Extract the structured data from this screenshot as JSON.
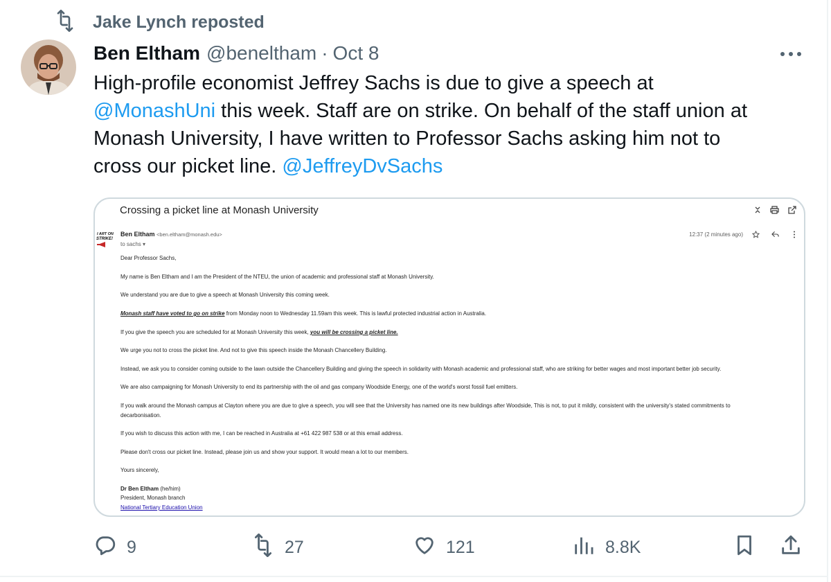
{
  "repost": {
    "label": "Jake Lynch reposted"
  },
  "author": {
    "name": "Ben Eltham",
    "handle": "@beneltham",
    "separator": "·",
    "date": "Oct 8"
  },
  "tweet": {
    "line1": "High-profile economist Jeffrey Sachs is due to give a speech at",
    "mention1": "@MonashUni",
    "line2_rest": " this week. Staff are on strike. On behalf of the staff union at",
    "line3": "Monash University, I have written to Professor Sachs asking him not to",
    "line4": "cross our picket line. ",
    "mention2": "@JeffreyDvSachs"
  },
  "email": {
    "subject": "Crossing a picket line at Monash University",
    "logo_text": "I ART ON STRIKE!",
    "sender_name": "Ben Eltham",
    "sender_email": "<ben.eltham@monash.edu>",
    "to": "to sachs",
    "time": "12:37 (2 minutes ago)",
    "salutation": "Dear Professor Sachs,",
    "p1": "My name is Ben Eltham and I am the President of the NTEU, the union of academic and professional staff at Monash University.",
    "p2": "We understand you are due to give a speech at Monash University this coming week.",
    "p3_em": "Monash staff have voted to go on strike",
    "p3_rest": " from Monday noon to Wednesday 11.59am this week. This is lawful protected industrial action in Australia.",
    "p4_pre": "If you give the speech you are scheduled for at Monash University this week, ",
    "p4_em": "you will be crossing a picket line.",
    "p5": "We urge you not to cross the picket line. And not to give this speech inside the Monash Chancellery Building.",
    "p6": "Instead, we ask you to consider coming outside to the lawn outside the Chancellery Building and giving the speech in solidarity with Monash academic and professional staff, who are striking for better wages and most important better job security.",
    "p7": "We are also campaigning for Monash University to end its partnership with the oil and gas  company Woodside Energy, one of the world's worst fossil fuel emitters.",
    "p8a": "If you walk around the Monash campus at Clayton where you are due to give a speech, you will see that the University has named one its new buildings after Woodside, This is not, to put it mildly, consistent with the university's stated commitments to",
    "p8b": "decarbonisation.",
    "p9": "If you wish to discuss this action with me, I can be reached in Australia at +61 422 987 538 or at this email address.",
    "p10": "Please don't cross our picket line. Instead, please join us and show your support. It would mean a lot to our members.",
    "closing": "Yours sincerely,",
    "sig_name": "Dr Ben Eltham",
    "sig_pronouns": " (he/him)",
    "sig_title": "President, Monash branch",
    "sig_link": "National Tertiary Education Union"
  },
  "stats": {
    "replies": "9",
    "reposts": "27",
    "likes": "121",
    "views": "8.8K"
  },
  "colors": {
    "accent": "#1d9bf0",
    "secondary_text": "#536471",
    "border": "#cfd9de"
  },
  "icons": [
    "repost-icon",
    "avatar",
    "more-icon",
    "collapse-icon",
    "print-icon",
    "external-link-icon",
    "strike-logo",
    "star-icon",
    "reply-icon",
    "kebab-icon",
    "reply-bubble-icon",
    "heart-icon",
    "views-icon",
    "bookmark-icon",
    "share-icon"
  ]
}
